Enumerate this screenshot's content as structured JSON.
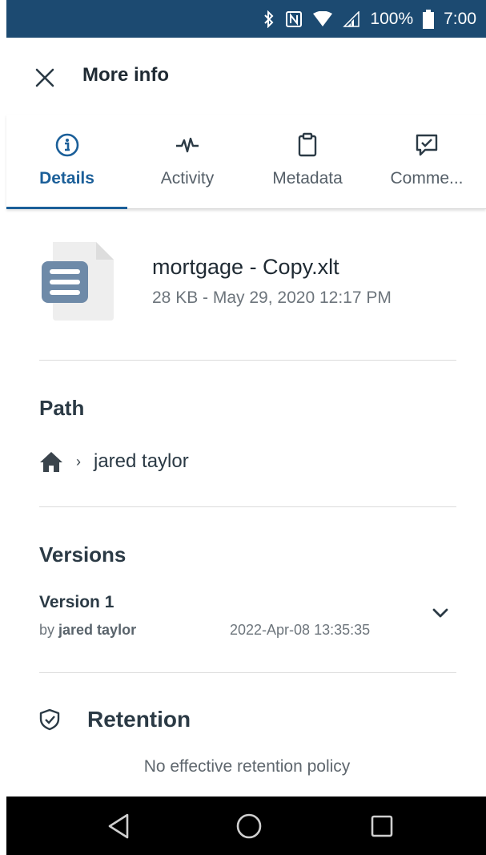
{
  "status_bar": {
    "battery": "100%",
    "time": "7:00",
    "icons": [
      "bluetooth-icon",
      "nfc-icon",
      "wifi-icon",
      "signal-icon",
      "battery-icon"
    ]
  },
  "app_bar": {
    "close_icon": "close-icon",
    "title": "More info"
  },
  "tabs": [
    {
      "label": "Details",
      "icon": "info-icon",
      "active": true
    },
    {
      "label": "Activity",
      "icon": "activity-pulse-icon",
      "active": false
    },
    {
      "label": "Metadata",
      "icon": "clipboard-icon",
      "active": false
    },
    {
      "label": "Comme...",
      "icon": "comment-check-icon",
      "active": false
    }
  ],
  "file": {
    "icon": "document-icon",
    "name": "mortgage - Copy.xlt",
    "meta": "28 KB - May 29, 2020 12:17 PM"
  },
  "path": {
    "title": "Path",
    "home_icon": "home-icon",
    "separator": "›",
    "folder": "jared taylor"
  },
  "versions": {
    "title": "Versions",
    "items": [
      {
        "name": "Version 1",
        "by_prefix": "by",
        "author": "jared taylor",
        "date": "2022-Apr-08 13:35:35"
      }
    ]
  },
  "retention": {
    "title": "Retention",
    "icon": "shield-check-icon",
    "text": "No effective retention policy"
  },
  "colors": {
    "status_bar": "#1c4a71",
    "accent": "#1b5f99",
    "nav_bar": "#000000"
  }
}
